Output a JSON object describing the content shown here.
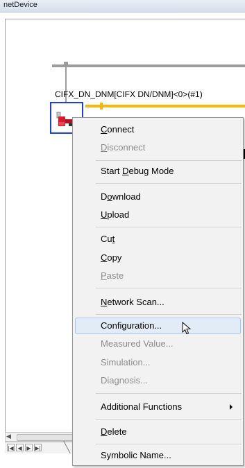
{
  "window": {
    "title": "netDevice"
  },
  "device": {
    "label": "CIFX_DN_DNM[CIFX DN/DNM]<0>(#1)"
  },
  "colors": {
    "bus_gray": "#9c9c9c",
    "bus_orange": "#f5b80b",
    "selection_box": "#1e3ee0",
    "menu_highlight": "#e2ecf7"
  },
  "navigation": {
    "buttons": [
      {
        "icon": "first-page-icon",
        "glyph": "|◀"
      },
      {
        "icon": "prev-page-icon",
        "glyph": "◀"
      },
      {
        "icon": "next-page-icon",
        "glyph": "▶"
      },
      {
        "icon": "last-page-icon",
        "glyph": "▶|"
      }
    ],
    "scroll_left_glyph": "◀"
  },
  "context_menu": {
    "items": [
      {
        "id": "connect",
        "pre": "",
        "ul": "C",
        "post": "onnect",
        "enabled": true
      },
      {
        "id": "disconnect",
        "pre": "",
        "ul": "D",
        "post": "isconnect",
        "enabled": false
      },
      {
        "id": "start-debug-mode",
        "pre": "Start ",
        "ul": "D",
        "post": "ebug Mode",
        "enabled": true
      },
      {
        "id": "download",
        "pre": "D",
        "ul": "o",
        "post": "wnload",
        "enabled": true
      },
      {
        "id": "upload",
        "pre": "",
        "ul": "U",
        "post": "pload",
        "enabled": true
      },
      {
        "id": "cut",
        "pre": "Cu",
        "ul": "t",
        "post": "",
        "enabled": true
      },
      {
        "id": "copy",
        "pre": "",
        "ul": "C",
        "post": "opy",
        "enabled": true
      },
      {
        "id": "paste",
        "pre": "",
        "ul": "P",
        "post": "aste",
        "enabled": false
      },
      {
        "id": "network-scan",
        "pre": "",
        "ul": "N",
        "post": "etwork Scan...",
        "enabled": true
      },
      {
        "id": "configuration",
        "pre": "Configuration...",
        "ul": "",
        "post": "",
        "enabled": true,
        "highlighted": true
      },
      {
        "id": "measured-value",
        "pre": "Measured Value...",
        "ul": "",
        "post": "",
        "enabled": false
      },
      {
        "id": "simulation",
        "pre": "Simulation...",
        "ul": "",
        "post": "",
        "enabled": false
      },
      {
        "id": "diagnosis",
        "pre": "Diagnosis...",
        "ul": "",
        "post": "",
        "enabled": false
      },
      {
        "id": "additional-functions",
        "pre": "Additional Functions",
        "ul": "",
        "post": "",
        "enabled": true,
        "has_submenu": true
      },
      {
        "id": "delete",
        "pre": "",
        "ul": "D",
        "post": "elete",
        "enabled": true
      },
      {
        "id": "symbolic-name",
        "pre": "Symbolic Name...",
        "ul": "",
        "post": "",
        "enabled": true
      }
    ]
  }
}
